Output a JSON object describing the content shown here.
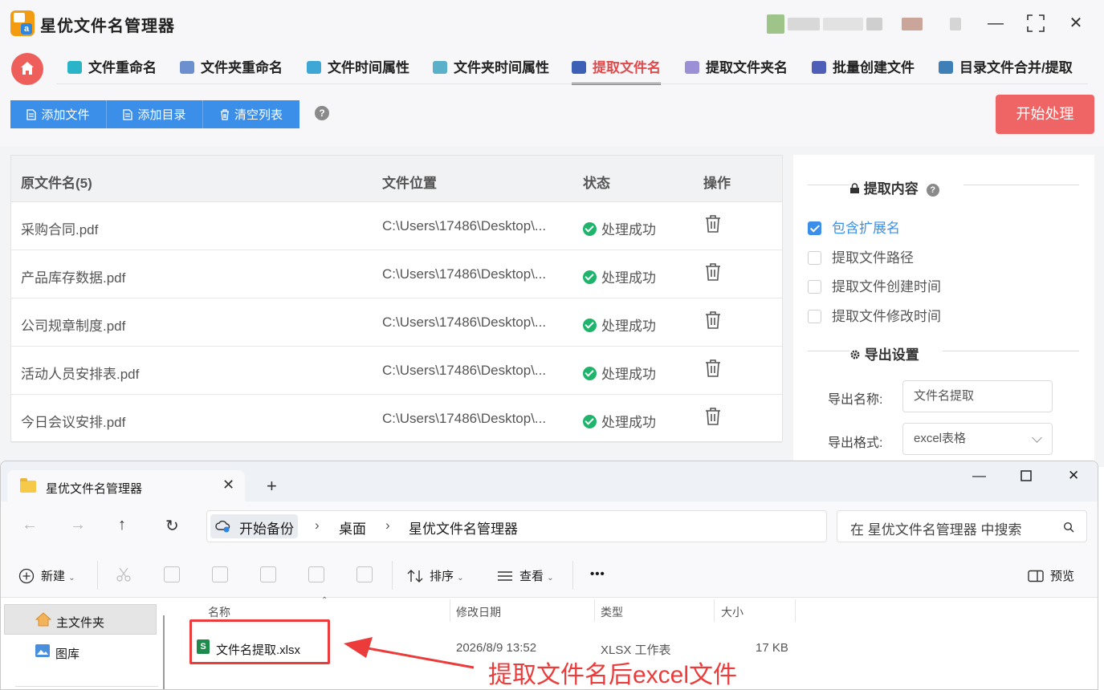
{
  "app": {
    "title": "星优文件名管理器",
    "accent": "#e04a4a",
    "primary": "#3b8fe8",
    "nav_tabs": [
      {
        "label": "文件重命名",
        "icon_color": "#2bb3c7"
      },
      {
        "label": "文件夹重命名",
        "icon_color": "#6b8fcf"
      },
      {
        "label": "文件时间属性",
        "icon_color": "#3fa7d6"
      },
      {
        "label": "文件夹时间属性",
        "icon_color": "#5ab0c9"
      },
      {
        "label": "提取文件名",
        "icon_color": "#3d5fb5",
        "active": true
      },
      {
        "label": "提取文件夹名",
        "icon_color": "#9b8fd6"
      },
      {
        "label": "批量创建文件",
        "icon_color": "#4f5fb8"
      },
      {
        "label": "目录文件合并/提取",
        "icon_color": "#3e7fb8"
      }
    ],
    "toolbar": {
      "add_file": "添加文件",
      "add_dir": "添加目录",
      "clear_list": "清空列表",
      "help": "?",
      "start": "开始处理"
    },
    "table": {
      "headers": [
        "原文件名(5)",
        "文件位置",
        "状态",
        "操作"
      ],
      "rows": [
        {
          "name": "采购合同.pdf",
          "path": "C:\\Users\\17486\\Desktop\\...",
          "status": "处理成功"
        },
        {
          "name": "产品库存数据.pdf",
          "path": "C:\\Users\\17486\\Desktop\\...",
          "status": "处理成功"
        },
        {
          "name": "公司规章制度.pdf",
          "path": "C:\\Users\\17486\\Desktop\\...",
          "status": "处理成功"
        },
        {
          "name": "活动人员安排表.pdf",
          "path": "C:\\Users\\17486\\Desktop\\...",
          "status": "处理成功"
        },
        {
          "name": "今日会议安排.pdf",
          "path": "C:\\Users\\17486\\Desktop\\...",
          "status": "处理成功"
        }
      ]
    },
    "panel": {
      "extract_title": "提取内容",
      "help": "?",
      "options": [
        {
          "label": "包含扩展名",
          "checked": true
        },
        {
          "label": "提取文件路径",
          "checked": false
        },
        {
          "label": "提取文件创建时间",
          "checked": false
        },
        {
          "label": "提取文件修改时间",
          "checked": false
        }
      ],
      "export_title": "导出设置",
      "export_name_label": "导出名称:",
      "export_name_value": "文件名提取",
      "export_format_label": "导出格式:",
      "export_format_value": "excel表格"
    }
  },
  "explorer": {
    "tab_title": "星优文件名管理器",
    "tab_close": "✕",
    "new_tab": "+",
    "breadcrumb": [
      "开始备份",
      "桌面",
      "星优文件名管理器"
    ],
    "search_placeholder": "在 星优文件名管理器 中搜索",
    "commands": {
      "new": "新建",
      "sort": "排序",
      "view": "查看",
      "more": "•••",
      "preview": "预览"
    },
    "sidebar": [
      {
        "label": "主文件夹",
        "selected": true
      },
      {
        "label": "图库",
        "selected": false
      }
    ],
    "columns": [
      "名称",
      "修改日期",
      "类型",
      "大小"
    ],
    "files": [
      {
        "name": "文件名提取.xlsx",
        "modified": "2026/8/9 13:52",
        "type": "XLSX 工作表",
        "size": "17 KB"
      }
    ]
  },
  "annotation": {
    "text": "提取文件名后excel文件",
    "color": "#ec3b3b"
  }
}
